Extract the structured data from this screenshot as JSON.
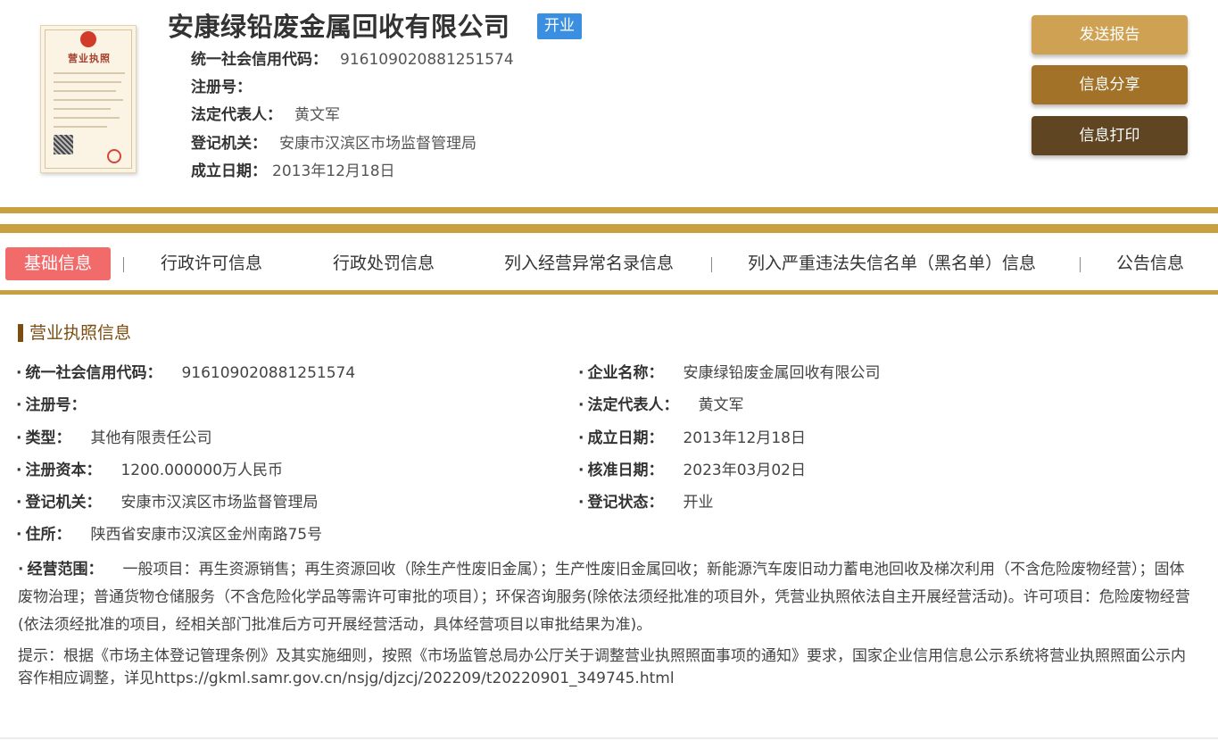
{
  "header": {
    "company_name": "安康绿铅废金属回收有限公司",
    "status": "开业",
    "license_title": "营业执照",
    "rows": [
      {
        "label": "统一社会信用代码：",
        "value": "916109020881251574"
      },
      {
        "label": "注册号：",
        "value": ""
      },
      {
        "label": "法定代表人：",
        "value": "黄文军"
      },
      {
        "label": "登记机关：",
        "value": "安康市汉滨区市场监督管理局"
      },
      {
        "label": "成立日期：",
        "value": "2013年12月18日"
      }
    ],
    "buttons": {
      "report": "发送报告",
      "share": "信息分享",
      "print": "信息打印"
    }
  },
  "tabs": [
    {
      "label": "基础信息"
    },
    {
      "label": "行政许可信息"
    },
    {
      "label": "行政处罚信息"
    },
    {
      "label": "列入经营异常名录信息"
    },
    {
      "label": "列入严重违法失信名单（黑名单）信息"
    },
    {
      "label": "公告信息"
    }
  ],
  "section": {
    "title": "营业执照信息",
    "dot": "·",
    "left_fields": [
      {
        "label": "统一社会信用代码：",
        "value": "916109020881251574"
      },
      {
        "label": "注册号：",
        "value": ""
      },
      {
        "label": "类型：",
        "value": "其他有限责任公司"
      },
      {
        "label": "注册资本：",
        "value": "1200.000000万人民币"
      },
      {
        "label": "登记机关：",
        "value": "安康市汉滨区市场监督管理局"
      },
      {
        "label": "住所：",
        "value": "陕西省安康市汉滨区金州南路75号"
      }
    ],
    "right_fields": [
      {
        "label": "企业名称：",
        "value": "安康绿铅废金属回收有限公司"
      },
      {
        "label": "法定代表人：",
        "value": "黄文军"
      },
      {
        "label": "成立日期：",
        "value": "2013年12月18日"
      },
      {
        "label": "核准日期：",
        "value": "2023年03月02日"
      },
      {
        "label": "登记状态：",
        "value": "开业"
      }
    ],
    "scope_label": "经营范围：",
    "scope_value": "一般项目：再生资源销售；再生资源回收（除生产性废旧金属）；生产性废旧金属回收；新能源汽车废旧动力蓄电池回收及梯次利用（不含危险废物经营）；固体废物治理；普通货物仓储服务（不含危险化学品等需许可审批的项目）；环保咨询服务(除依法须经批准的项目外，凭营业执照依法自主开展经营活动)。许可项目：危险废物经营(依法须经批准的项目，经相关部门批准后方可开展经营活动，具体经营项目以审批结果为准)。",
    "note": "提示：根据《市场主体登记管理条例》及其实施细则，按照《市场监管总局办公厅关于调整营业执照照面事项的通知》要求，国家企业信用信息公示系统将营业执照照面公示内容作相应调整，详见https://gkml.samr.gov.cn/nsjg/djzcj/202209/t20220901_349745.html"
  }
}
